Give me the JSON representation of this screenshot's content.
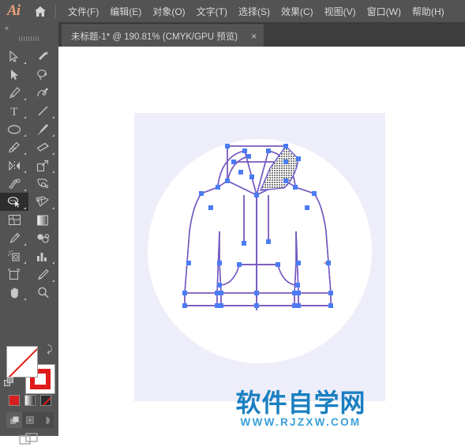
{
  "app": {
    "name": "Adobe Illustrator",
    "logo_text": "Ai",
    "logo_color": "#e8a07a",
    "chrome_color": "#535353",
    "home_icon": "home-icon"
  },
  "menubar": {
    "items": [
      {
        "label": "文件(F)",
        "name": "menu-file"
      },
      {
        "label": "编辑(E)",
        "name": "menu-edit"
      },
      {
        "label": "对象(O)",
        "name": "menu-object"
      },
      {
        "label": "文字(T)",
        "name": "menu-type"
      },
      {
        "label": "选择(S)",
        "name": "menu-select"
      },
      {
        "label": "效果(C)",
        "name": "menu-effect"
      },
      {
        "label": "视图(V)",
        "name": "menu-view"
      },
      {
        "label": "窗口(W)",
        "name": "menu-window"
      },
      {
        "label": "帮助(H)",
        "name": "menu-help"
      }
    ]
  },
  "tabbar": {
    "tab": {
      "title": "未标题-1* @ 190.81% (CMYK/GPU 预览)",
      "document_name": "未标题-1",
      "modified": true,
      "zoom": "190.81%",
      "color_mode": "CMYK",
      "preview_mode": "GPU 预览",
      "close_label": "×"
    }
  },
  "toolpanel": {
    "collapse_label": "«",
    "grip": "drag-handle",
    "selected_tool": "lasso-tool",
    "rows": [
      [
        {
          "icon": "selection-tool",
          "has_flyout": true
        },
        {
          "icon": "magic-wand-tool",
          "has_flyout": false
        }
      ],
      [
        {
          "icon": "direct-selection-tool",
          "has_flyout": true
        },
        {
          "icon": "lasso-tool-top",
          "has_flyout": false
        }
      ],
      [
        {
          "icon": "pen-tool",
          "has_flyout": true
        },
        {
          "icon": "curvature-tool",
          "has_flyout": false
        }
      ],
      [
        {
          "icon": "type-tool",
          "has_flyout": true
        },
        {
          "icon": "line-segment-tool",
          "has_flyout": true
        }
      ],
      [
        {
          "icon": "ellipse-tool",
          "has_flyout": true
        },
        {
          "icon": "paintbrush-tool",
          "has_flyout": true
        }
      ],
      [
        {
          "icon": "shaper-tool",
          "has_flyout": true
        },
        {
          "icon": "eraser-tool",
          "has_flyout": true
        }
      ],
      [
        {
          "icon": "reflect-tool",
          "has_flyout": true
        },
        {
          "icon": "scale-tool",
          "has_flyout": true
        }
      ],
      [
        {
          "icon": "width-tool",
          "has_flyout": true
        },
        {
          "icon": "free-transform-tool",
          "has_flyout": false
        }
      ],
      [
        {
          "icon": "lasso-tool",
          "has_flyout": true
        },
        {
          "icon": "perspective-grid-tool",
          "has_flyout": true
        }
      ],
      [
        {
          "icon": "mesh-tool",
          "has_flyout": false
        },
        {
          "icon": "gradient-tool",
          "has_flyout": false
        }
      ],
      [
        {
          "icon": "eyedropper-tool",
          "has_flyout": true
        },
        {
          "icon": "blend-tool",
          "has_flyout": false
        }
      ],
      [
        {
          "icon": "symbol-sprayer-tool",
          "has_flyout": true
        },
        {
          "icon": "column-graph-tool",
          "has_flyout": true
        }
      ],
      [
        {
          "icon": "artboard-tool",
          "has_flyout": false
        },
        {
          "icon": "slice-tool",
          "has_flyout": true
        }
      ],
      [
        {
          "icon": "hand-tool",
          "has_flyout": true
        },
        {
          "icon": "zoom-tool",
          "has_flyout": false
        }
      ]
    ],
    "colors": {
      "fill": {
        "name": "fill-swatch",
        "value": "#ffffff",
        "is_none": true
      },
      "stroke": {
        "name": "stroke-swatch",
        "value": "#e01b1b"
      },
      "swap_icon": "swap-fill-stroke-icon",
      "default_icon": "default-fill-stroke-icon"
    },
    "color_modes": [
      {
        "name": "color-swatch-mode",
        "value": "#d81f1f"
      },
      {
        "name": "gradient-mode",
        "value": "gradient"
      },
      {
        "name": "none-mode",
        "value": "none"
      }
    ],
    "draw_modes": [
      {
        "name": "draw-normal-mode",
        "active": true
      },
      {
        "name": "draw-behind-mode",
        "active": false
      },
      {
        "name": "draw-inside-mode",
        "active": false
      }
    ],
    "screen_mode": {
      "name": "change-screen-mode",
      "icon": "screen-mode-icon"
    }
  },
  "canvas": {
    "background": "#ffffff",
    "artboard": {
      "background": "#eeeefa",
      "circle_color": "#ffffff",
      "artwork_name": "hoodie-vector-artwork",
      "path_stroke": "#c9564f",
      "selection_color": "#4a6cf0",
      "anchor_color": "#4a7cf5",
      "pattern_fill": "halftone-dots"
    }
  },
  "watermark": {
    "chinese": "软件自学网",
    "url": "WWW.RJZXW.COM",
    "color": "#1a7fc1"
  }
}
